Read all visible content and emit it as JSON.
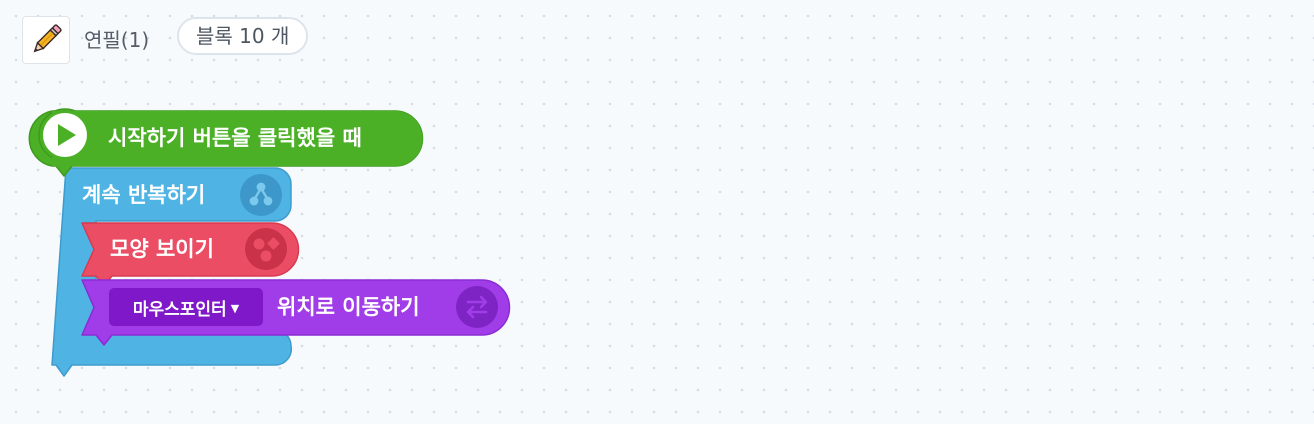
{
  "header": {
    "object_name": "연필(1)",
    "block_count": "블록 10 개",
    "thumbnail_icon": "pencil-icon"
  },
  "blocks": {
    "start": {
      "label": "시작하기 버튼을 클릭했을 때",
      "icon": "play-icon",
      "color": "#4cb027"
    },
    "loop": {
      "label": "계속 반복하기",
      "icon": "repeat-flow-icon",
      "color": "#4fb4e4"
    },
    "show": {
      "label": "모양 보이기",
      "icon": "shapes-icon",
      "color": "#ea4d64"
    },
    "move": {
      "target_value": "마우스포인터",
      "label": "위치로 이동하기",
      "icon": "move-arrows-icon",
      "color": "#a03ce8",
      "dropdown_color": "#7e18c9"
    }
  }
}
